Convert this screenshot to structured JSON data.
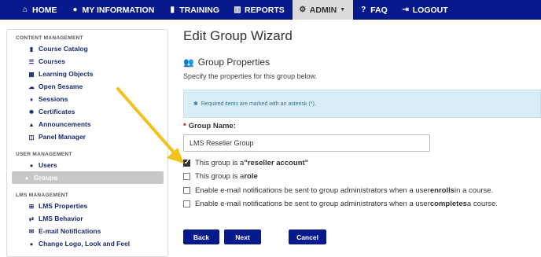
{
  "nav": {
    "items": [
      {
        "label": "HOME",
        "icon": "home-icon"
      },
      {
        "label": "MY INFORMATION",
        "icon": "user-icon"
      },
      {
        "label": "TRAINING",
        "icon": "book-icon"
      },
      {
        "label": "REPORTS",
        "icon": "chart-icon"
      },
      {
        "label": "ADMIN",
        "icon": "gear-icon"
      },
      {
        "label": "FAQ",
        "icon": "question-icon"
      },
      {
        "label": "LOGOUT",
        "icon": "logout-icon"
      }
    ],
    "active": "ADMIN"
  },
  "sidebar": {
    "content_management": {
      "heading": "CONTENT MANAGEMENT",
      "items": [
        {
          "label": "Course Catalog",
          "icon": "book-icon"
        },
        {
          "label": "Courses",
          "icon": "list-icon"
        },
        {
          "label": "Learning Objects",
          "icon": "grid-icon"
        },
        {
          "label": "Open Sesame",
          "icon": "cloud-icon"
        },
        {
          "label": "Sessions",
          "icon": "pin-icon"
        },
        {
          "label": "Certificates",
          "icon": "certificate-icon"
        },
        {
          "label": "Announcements",
          "icon": "bell-icon"
        },
        {
          "label": "Panel Manager",
          "icon": "panel-icon"
        }
      ]
    },
    "user_management": {
      "heading": "USER MANAGEMENT",
      "items": [
        {
          "label": "Users",
          "icon": "user-icon"
        },
        {
          "label": "Groups",
          "icon": "users-icon",
          "active": true
        }
      ]
    },
    "lms_management": {
      "heading": "LMS MANAGEMENT",
      "items": [
        {
          "label": "LMS Properties",
          "icon": "sitemap-icon"
        },
        {
          "label": "LMS Behavior",
          "icon": "exchange-icon"
        },
        {
          "label": "E-mail Notifications",
          "icon": "envelope-icon"
        },
        {
          "label": "Change Logo, Look and Feel",
          "icon": "drop-icon"
        }
      ]
    }
  },
  "main": {
    "title": "Edit Group Wizard",
    "section_title": "Group Properties",
    "section_desc": "Specify the properties for this group below.",
    "info": "Required items are marked with an asterisk (*).",
    "name_label": "Group Name:",
    "name_required": "*",
    "name_value": "LMS Reseller Group",
    "options": [
      {
        "pre": "This group is a ",
        "bold": "\"reseller account\"",
        "post": "",
        "checked": true
      },
      {
        "pre": "This group is a ",
        "bold": "role",
        "post": "",
        "checked": false
      },
      {
        "pre": "Enable e-mail notifications be sent to group administrators when a user ",
        "bold": "enrolls",
        "post": " in a course.",
        "checked": false
      },
      {
        "pre": "Enable e-mail notifications be sent to group administrators when a user ",
        "bold": "completes",
        "post": " a course.",
        "checked": false
      }
    ],
    "buttons": {
      "back": "Back",
      "next": "Next",
      "cancel": "Cancel"
    }
  },
  "colors": {
    "nav_bg": "#061a8c",
    "arrow": "#f2c21b",
    "info_bg": "#d9edf7"
  }
}
